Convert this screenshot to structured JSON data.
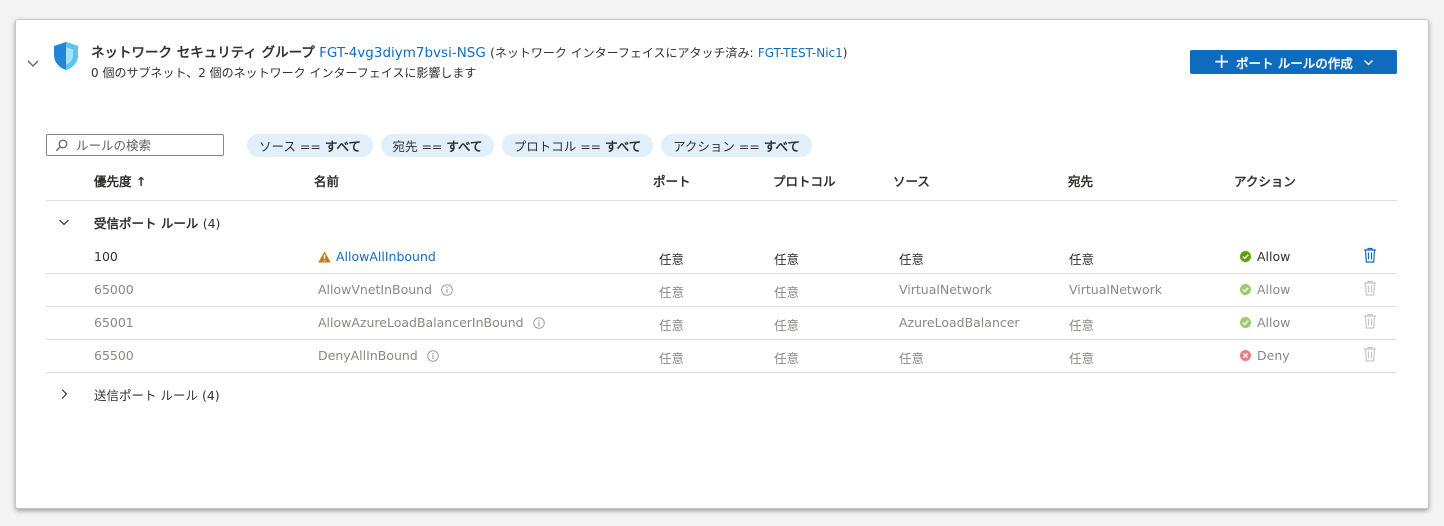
{
  "header": {
    "title_prefix": "ネットワーク セキュリティ グループ",
    "nsg_name": "FGT-4vg3diym7bvsi-NSG",
    "attach_prefix": "(ネットワーク インターフェイスにアタッチ済み:",
    "nic_name": "FGT-TEST-Nic1",
    "attach_suffix": ")",
    "subtitle": "0 個のサブネット、2 個のネットワーク インターフェイスに影響します"
  },
  "create_button": {
    "label": "ポート ルールの作成"
  },
  "search": {
    "placeholder": "ルールの検索"
  },
  "filters": [
    {
      "label": "ソース ==",
      "value": "すべて"
    },
    {
      "label": "宛先 ==",
      "value": "すべて"
    },
    {
      "label": "プロトコル ==",
      "value": "すべて"
    },
    {
      "label": "アクション ==",
      "value": "すべて"
    }
  ],
  "columns": {
    "priority": "優先度 ↑",
    "name": "名前",
    "port": "ポート",
    "protocol": "プロトコル",
    "source": "ソース",
    "destination": "宛先",
    "action": "アクション"
  },
  "inbound": {
    "label": "受信ポート ルール",
    "count": "(4)",
    "rules": [
      {
        "priority": "100",
        "name": "AllowAllInbound",
        "port": "任意",
        "protocol": "任意",
        "source": "任意",
        "destination": "任意",
        "action": "Allow"
      },
      {
        "priority": "65000",
        "name": "AllowVnetInBound",
        "port": "任意",
        "protocol": "任意",
        "source": "VirtualNetwork",
        "destination": "VirtualNetwork",
        "action": "Allow"
      },
      {
        "priority": "65001",
        "name": "AllowAzureLoadBalancerInBound",
        "port": "任意",
        "protocol": "任意",
        "source": "AzureLoadBalancer",
        "destination": "任意",
        "action": "Allow"
      },
      {
        "priority": "65500",
        "name": "DenyAllInBound",
        "port": "任意",
        "protocol": "任意",
        "source": "任意",
        "destination": "任意",
        "action": "Deny"
      }
    ]
  },
  "outbound": {
    "label": "送信ポート ルール",
    "count": "(4)"
  },
  "colors": {
    "accent": "#0f6cbd",
    "pill_bg": "#e1effa",
    "allow": "#57a300",
    "deny": "#e00b1c",
    "warning": "#d47500",
    "muted_text": "#8a8886"
  }
}
